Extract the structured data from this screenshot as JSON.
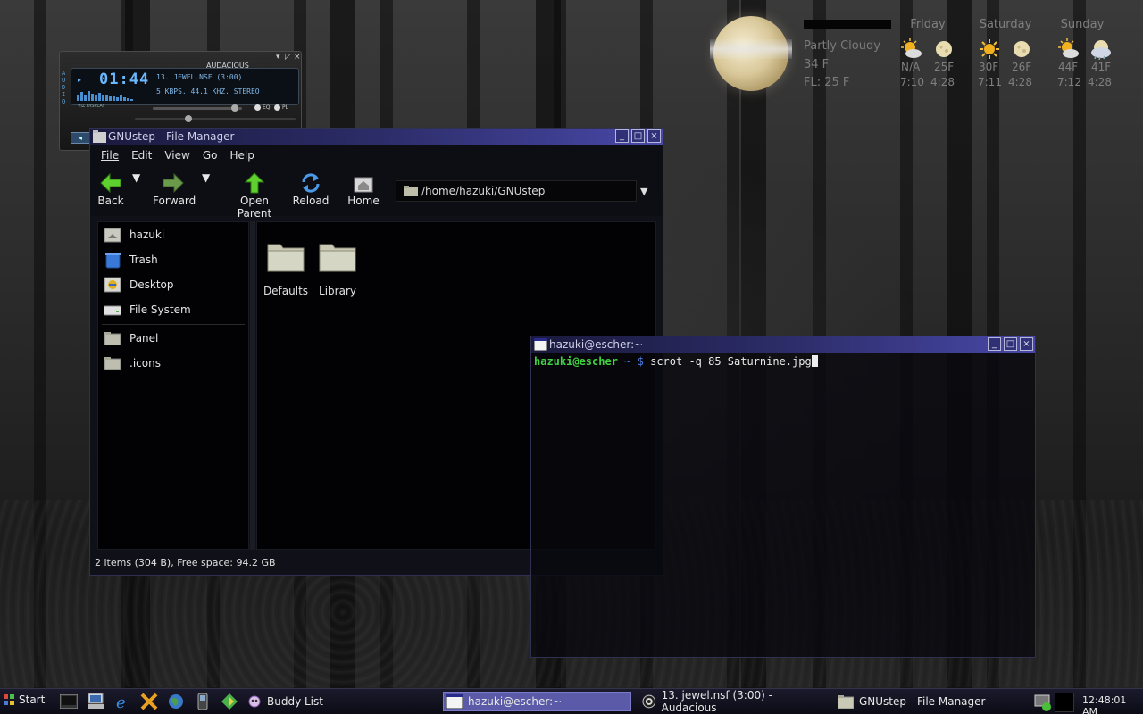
{
  "audacious": {
    "app_name": "AUDACIOUS",
    "time": "01:44",
    "track": "13. JEWEL.NSF (3:00)",
    "info": "5 KBPS. 44.1 KHZ. STEREO",
    "viz_label": "VIZ DISPLAY",
    "eq_label": "EQ",
    "pl_label": "PL",
    "side_logo": "AUDIO",
    "viz_levels": [
      0.5,
      0.8,
      0.6,
      0.9,
      0.7,
      0.55,
      0.75,
      0.6,
      0.5,
      0.45,
      0.4,
      0.35,
      0.5,
      0.3,
      0.25,
      0.2
    ]
  },
  "file_manager": {
    "title": "GNUstep - File Manager",
    "menu": [
      "File",
      "Edit",
      "View",
      "Go",
      "Help"
    ],
    "toolbar": {
      "back": "Back",
      "forward": "Forward",
      "open_parent": "Open Parent",
      "reload": "Reload",
      "home": "Home"
    },
    "path": "/home/hazuki/GNUstep",
    "sidebar": [
      "hazuki",
      "Trash",
      "Desktop",
      "File System",
      "Panel",
      ".icons"
    ],
    "items": [
      "Defaults",
      "Library"
    ],
    "status": "2 items (304 B), Free space: 94.2 GB"
  },
  "terminal": {
    "title": "hazuki@escher:~",
    "prompt_user": "hazuki@escher",
    "prompt_dir": "~",
    "prompt_symbol": "$",
    "command": "scrot -q 85 Saturnine.jpg"
  },
  "weather": {
    "condition": "Partly Cloudy",
    "temp": "34 F",
    "feels_like": "FL: 25 F",
    "days": [
      {
        "name": "Friday",
        "hi": "N/A",
        "lo": "25F",
        "rise": "7:10",
        "set": "4:28",
        "day_icon": "partly-cloudy-icon",
        "night_icon": "moon-icon"
      },
      {
        "name": "Saturday",
        "hi": "30F",
        "lo": "26F",
        "rise": "7:11",
        "set": "4:28",
        "day_icon": "sun-icon",
        "night_icon": "moon-icon"
      },
      {
        "name": "Sunday",
        "hi": "44F",
        "lo": "41F",
        "rise": "7:12",
        "set": "4:28",
        "day_icon": "partly-cloudy-icon",
        "night_icon": "cloudy-moon-icon"
      }
    ]
  },
  "taskbar": {
    "start": "Start",
    "buddy_list": "Buddy List",
    "windows": [
      {
        "label": "hazuki@escher:~",
        "active": true
      },
      {
        "label": "13. jewel.nsf (3:00) - Audacious",
        "active": false
      },
      {
        "label": "GNUstep - File Manager",
        "active": false
      }
    ],
    "clock": "12:48:01 AM"
  },
  "colors": {
    "titlebar_start": "#1a1a3e",
    "titlebar_end": "#4848a8",
    "prompt_user": "#3fd33f",
    "prompt_path": "#4d7fe6",
    "taskbar_active": "#5a5aa8"
  }
}
